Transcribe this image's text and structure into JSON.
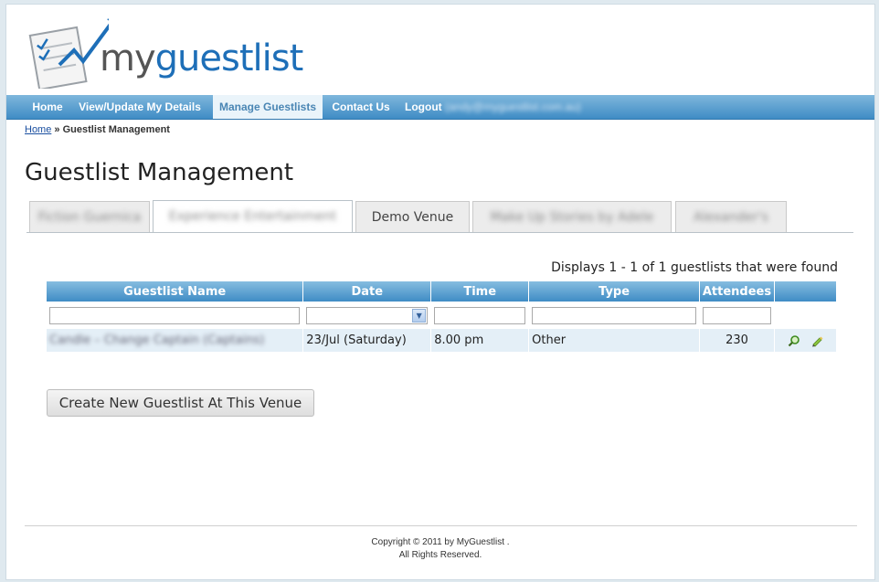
{
  "logo": {
    "word_my": "my",
    "word_guestlist": "guestlist"
  },
  "nav": {
    "items": [
      {
        "label": "Home"
      },
      {
        "label": "View/Update My Details"
      },
      {
        "label": "Manage Guestlists",
        "active": true
      },
      {
        "label": "Contact Us"
      },
      {
        "label": "Logout"
      }
    ],
    "logout_email": "(andy@myguestlist.com.au)"
  },
  "breadcrumb": {
    "home": "Home",
    "separator": "»",
    "current": "Guestlist Management"
  },
  "page_title": "Guestlist Management",
  "tabs": [
    {
      "label": "Fiction Guernica",
      "blurred": true
    },
    {
      "label": "Experience Entertainment",
      "blurred": true,
      "active": true
    },
    {
      "label": "Demo Venue",
      "blurred": false
    },
    {
      "label": "Make Up Stories by Adele",
      "blurred": true
    },
    {
      "label": "Alexander's",
      "blurred": true
    }
  ],
  "results": {
    "summary": "Displays 1 - 1 of 1 guestlists that were found"
  },
  "table": {
    "columns": [
      "Guestlist Name",
      "Date",
      "Time",
      "Type",
      "Attendees"
    ],
    "filters": {
      "name": "",
      "date": "",
      "time": "",
      "type": "",
      "attendees": ""
    },
    "rows": [
      {
        "name": "Candle – Change Captain (Captains)",
        "date": "23/Jul (Saturday)",
        "time": "8.00 pm",
        "type": "Other",
        "attendees": "230"
      }
    ]
  },
  "actions": {
    "create_label": "Create New Guestlist At This Venue"
  },
  "footer": {
    "line1": "Copyright © 2011 by MyGuestlist .",
    "line2": "All Rights Reserved."
  },
  "colors": {
    "nav_top": "#7fb7dc",
    "nav_bottom": "#3f8cc5",
    "row_bg": "#e4eff7",
    "brand_blue": "#1e6fb8"
  }
}
